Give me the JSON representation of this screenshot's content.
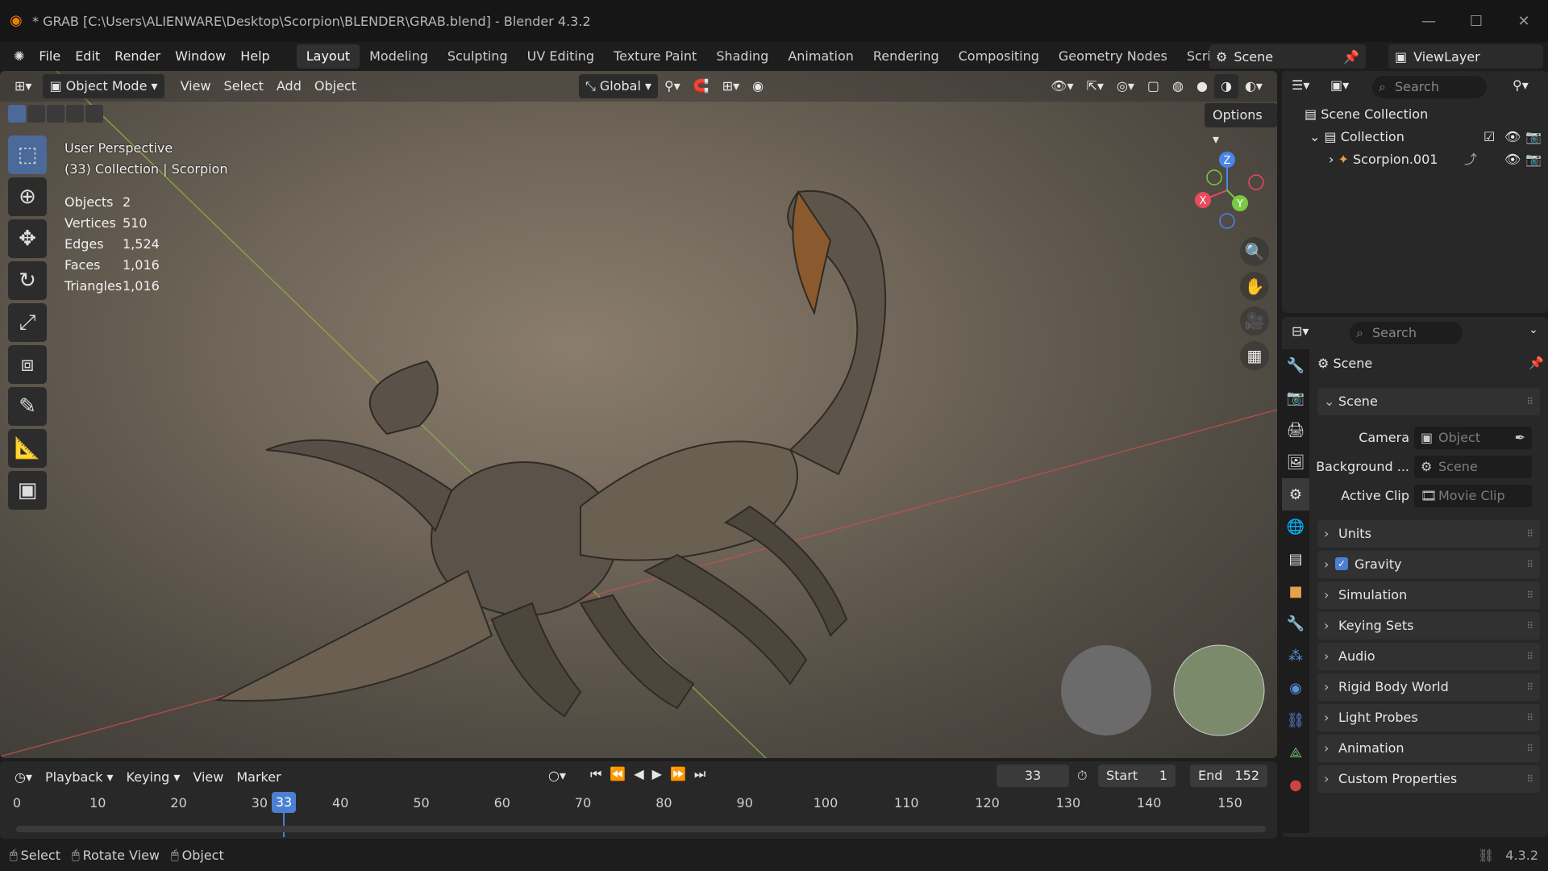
{
  "title_bar": {
    "title": "* GRAB [C:\\Users\\ALIENWARE\\Desktop\\Scorpion\\BLENDER\\GRAB.blend] - Blender 4.3.2"
  },
  "menu": [
    "File",
    "Edit",
    "Render",
    "Window",
    "Help"
  ],
  "workspaces": [
    "Layout",
    "Modeling",
    "Sculpting",
    "UV Editing",
    "Texture Paint",
    "Shading",
    "Animation",
    "Rendering",
    "Compositing",
    "Geometry Nodes",
    "Scripting"
  ],
  "scene_name": "Scene",
  "view_layer": "ViewLayer",
  "viewport": {
    "mode": "Object Mode",
    "menus": [
      "View",
      "Select",
      "Add",
      "Object"
    ],
    "orientation": "Global",
    "options": "Options",
    "perspective": "User Perspective",
    "collection_line": "(33) Collection | Scorpion",
    "stats": [
      {
        "k": "Objects",
        "v": "2"
      },
      {
        "k": "Vertices",
        "v": "510"
      },
      {
        "k": "Edges",
        "v": "1,524"
      },
      {
        "k": "Faces",
        "v": "1,016"
      },
      {
        "k": "Triangles",
        "v": "1,016"
      }
    ],
    "gizmo": {
      "z": "Z",
      "x": "X",
      "y": "Y"
    }
  },
  "outliner": {
    "search": "Search",
    "items": [
      "Scene Collection",
      "Collection",
      "Scorpion.001"
    ]
  },
  "properties": {
    "search": "Search",
    "header": "Scene",
    "scene_panel": "Scene",
    "fields": [
      {
        "label": "Camera",
        "value": "Object"
      },
      {
        "label": "Background ...",
        "value": "Scene"
      },
      {
        "label": "Active Clip",
        "value": "Movie Clip"
      }
    ],
    "panels": [
      "Units",
      "Gravity",
      "Simulation",
      "Keying Sets",
      "Audio",
      "Rigid Body World",
      "Light Probes",
      "Animation",
      "Custom Properties"
    ]
  },
  "timeline": {
    "menus": [
      "Playback",
      "Keying",
      "View",
      "Marker"
    ],
    "current_frame": "33",
    "start_label": "Start",
    "start": "1",
    "end_label": "End",
    "end": "152",
    "ticks": [
      "0",
      "10",
      "20",
      "30",
      "40",
      "50",
      "60",
      "70",
      "80",
      "90",
      "100",
      "110",
      "120",
      "130",
      "140",
      "150"
    ]
  },
  "status_bar": {
    "hints": [
      "Select",
      "Rotate View",
      "Object"
    ],
    "version": "4.3.2"
  }
}
